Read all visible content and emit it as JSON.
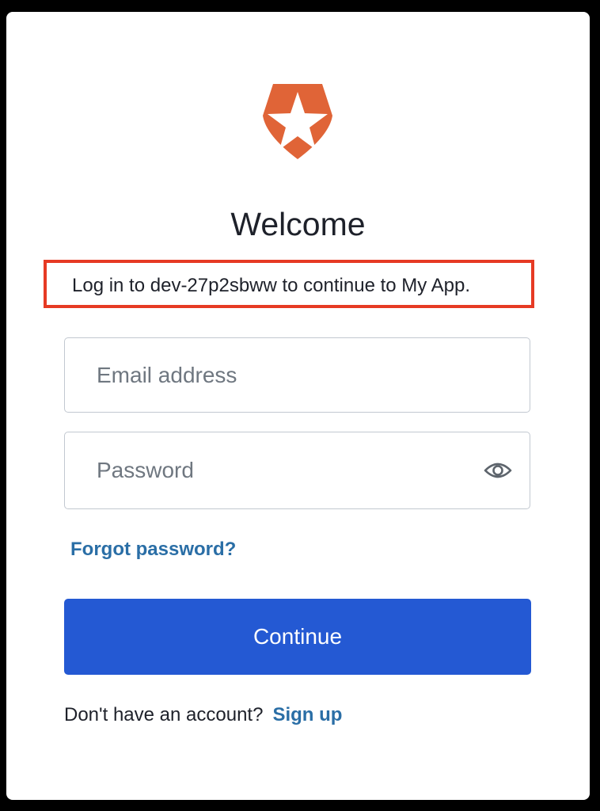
{
  "logo": {
    "icon": "auth0-shield-star-icon",
    "color": "#e06437"
  },
  "header": {
    "title": "Welcome",
    "subtitle": "Log in to dev-27p2sbww to continue to My App."
  },
  "form": {
    "email_placeholder": "Email address",
    "email_value": "",
    "password_placeholder": "Password",
    "password_value": "",
    "show_password_icon": "eye-icon",
    "forgot_password_label": "Forgot password?",
    "continue_label": "Continue"
  },
  "footer": {
    "prompt": "Don't have an account?",
    "signup_label": "Sign up"
  },
  "colors": {
    "primary_button": "#2459d3",
    "link": "#2a6ea6",
    "highlight_border": "#e63a24"
  }
}
